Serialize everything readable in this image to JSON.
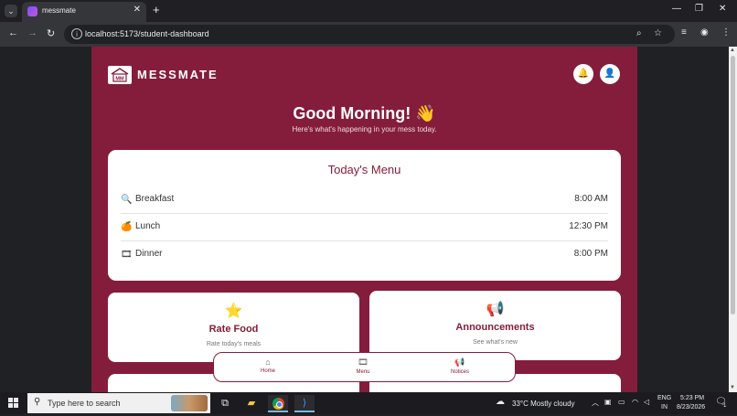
{
  "browser": {
    "tab_title": "messmate",
    "new_tab": "+",
    "url": "localhost:5173/student-dashboard"
  },
  "app": {
    "brand": "MESSMATE",
    "greeting": "Good Morning! 👋",
    "subtitle": "Here's what's happening in your mess today."
  },
  "menu": {
    "title": "Today's Menu",
    "meals": [
      {
        "name": "Breakfast",
        "time": "8:00 AM",
        "icon": "search-icon"
      },
      {
        "name": "Lunch",
        "time": "12:30 PM",
        "icon": "orange-icon"
      },
      {
        "name": "Dinner",
        "time": "8:00 PM",
        "icon": "film-icon"
      }
    ]
  },
  "cards": {
    "rate": {
      "title": "Rate Food",
      "subtitle": "Rate today's meals",
      "icon": "star-icon"
    },
    "announcements": {
      "title": "Announcements",
      "subtitle": "See what's new",
      "icon": "megaphone-icon"
    }
  },
  "bottom_nav": [
    {
      "label": "Home",
      "icon": "home-icon"
    },
    {
      "label": "Menu",
      "icon": "menu-icon"
    },
    {
      "label": "Notices",
      "icon": "megaphone-icon"
    }
  ],
  "taskbar": {
    "search_placeholder": "Type here to search",
    "weather": "33°C  Mostly cloudy",
    "lang_top": "ENG",
    "lang_bottom": "IN",
    "time": "5:23 PM",
    "date": "8/23/2026",
    "notification_count": "1"
  },
  "colors": {
    "brand": "#841d3b",
    "card": "#ffffff"
  }
}
